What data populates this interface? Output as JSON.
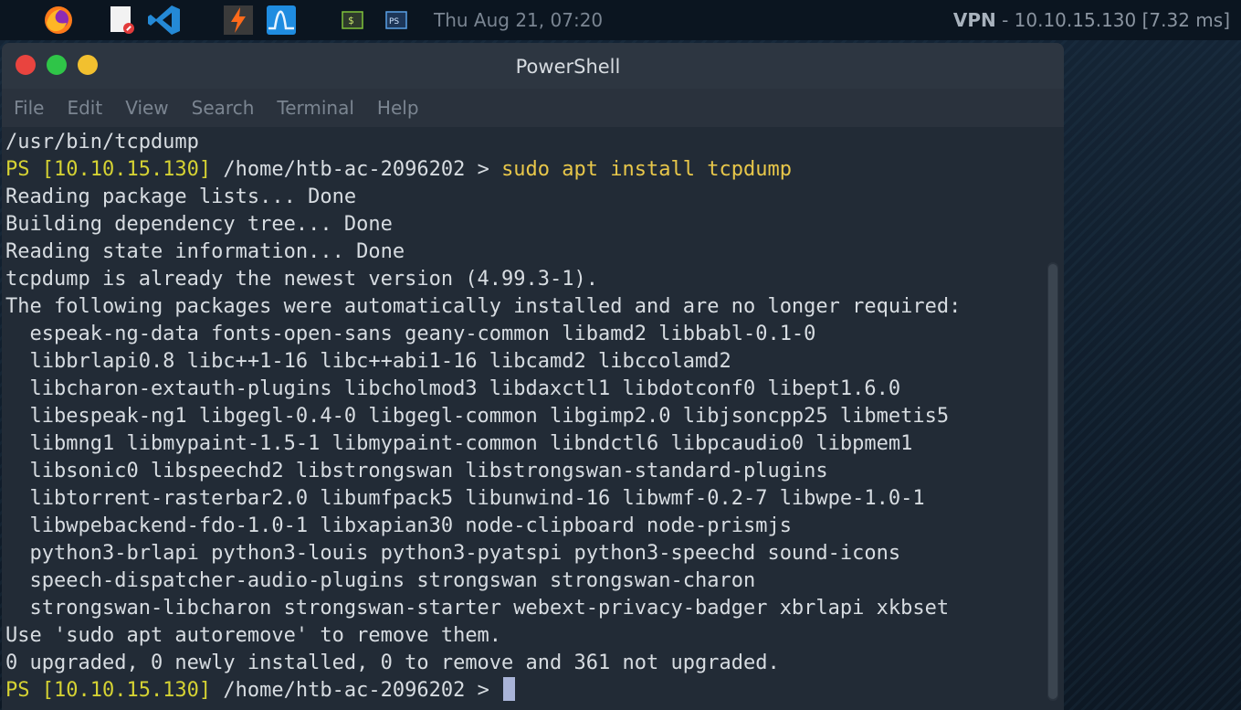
{
  "taskbar": {
    "icons": [
      "firefox-icon",
      "text-editor-icon",
      "vscode-icon",
      "burp-icon",
      "monitor-icon",
      "terminal-icon",
      "powershell-icon"
    ],
    "clock": "Thu Aug 21, 07:20",
    "vpn_label": "VPN",
    "vpn_info": " - 10.10.15.130 [7.32 ms]"
  },
  "window": {
    "title": "PowerShell",
    "menu": [
      "File",
      "Edit",
      "View",
      "Search",
      "Terminal",
      "Help"
    ]
  },
  "terminal": {
    "line0": "/usr/bin/tcpdump",
    "prompt1_ps": "PS [10.10.15.130]",
    "prompt1_path": " /home/htb-ac-2096202 > ",
    "prompt1_cmd": "sudo apt install tcpdump",
    "line2": "Reading package lists... Done",
    "line3": "Building dependency tree... Done",
    "line4": "Reading state information... Done",
    "line5": "tcpdump is already the newest version (4.99.3-1).",
    "line6": "The following packages were automatically installed and are no longer required:",
    "line7": "  espeak-ng-data fonts-open-sans geany-common libamd2 libbabl-0.1-0",
    "line8": "  libbrlapi0.8 libc++1-16 libc++abi1-16 libcamd2 libccolamd2",
    "line9": "  libcharon-extauth-plugins libcholmod3 libdaxctl1 libdotconf0 libept1.6.0",
    "line10": "  libespeak-ng1 libgegl-0.4-0 libgegl-common libgimp2.0 libjsoncpp25 libmetis5",
    "line11": "  libmng1 libmypaint-1.5-1 libmypaint-common libndctl6 libpcaudio0 libpmem1",
    "line12": "  libsonic0 libspeechd2 libstrongswan libstrongswan-standard-plugins",
    "line13": "  libtorrent-rasterbar2.0 libumfpack5 libunwind-16 libwmf-0.2-7 libwpe-1.0-1",
    "line14": "  libwpebackend-fdo-1.0-1 libxapian30 node-clipboard node-prismjs",
    "line15": "  python3-brlapi python3-louis python3-pyatspi python3-speechd sound-icons",
    "line16": "  speech-dispatcher-audio-plugins strongswan strongswan-charon",
    "line17": "  strongswan-libcharon strongswan-starter webext-privacy-badger xbrlapi xkbset",
    "line18": "Use 'sudo apt autoremove' to remove them.",
    "line19": "0 upgraded, 0 newly installed, 0 to remove and 361 not upgraded.",
    "prompt2_ps": "PS [10.10.15.130]",
    "prompt2_path": " /home/htb-ac-2096202 > "
  },
  "colors": {
    "prompt": "#d5d233",
    "command": "#e8c74a",
    "text": "#d7dce1",
    "close": "#e9443f",
    "maximize": "#2fc548",
    "minimize": "#f2c02f"
  }
}
